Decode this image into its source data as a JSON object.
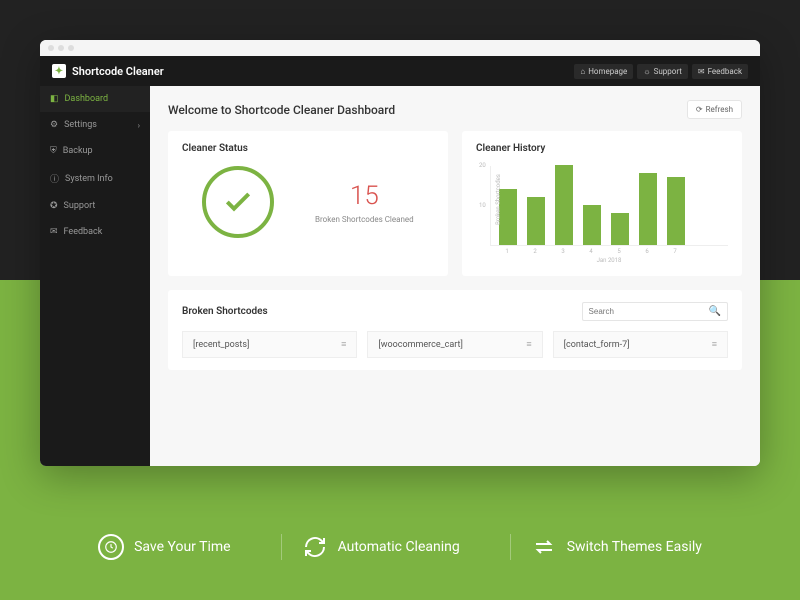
{
  "brand": "Shortcode Cleaner",
  "toplinks": {
    "home": "Homepage",
    "support": "Support",
    "feedback": "Feedback"
  },
  "sidebar": {
    "items": [
      {
        "label": "Dashboard"
      },
      {
        "label": "Settings"
      },
      {
        "label": "Backup"
      },
      {
        "label": "System Info"
      },
      {
        "label": "Support"
      },
      {
        "label": "Feedback"
      }
    ]
  },
  "page": {
    "title": "Welcome to Shortcode Cleaner Dashboard",
    "refresh": "Refresh"
  },
  "status": {
    "title": "Cleaner Status",
    "count": "15",
    "label": "Broken Shortcodes Cleaned"
  },
  "history": {
    "title": "Cleaner History"
  },
  "broken": {
    "title": "Broken Shortcodes",
    "search_placeholder": "Search",
    "items": [
      "[recent_posts]",
      "[woocommerce_cart]",
      "[contact_form-7]"
    ]
  },
  "features": {
    "f1": "Save Your Time",
    "f2": "Automatic Cleaning",
    "f3": "Switch Themes Easily"
  },
  "chart_data": {
    "type": "bar",
    "categories": [
      "1",
      "2",
      "3",
      "4",
      "5",
      "6",
      "7"
    ],
    "values": [
      14,
      12,
      20,
      10,
      8,
      18,
      17
    ],
    "title": "Cleaner History",
    "xlabel": "Jan 2018",
    "ylabel": "Broken Shortcodes",
    "ylim": [
      0,
      20
    ],
    "yticks": [
      10,
      20
    ]
  }
}
